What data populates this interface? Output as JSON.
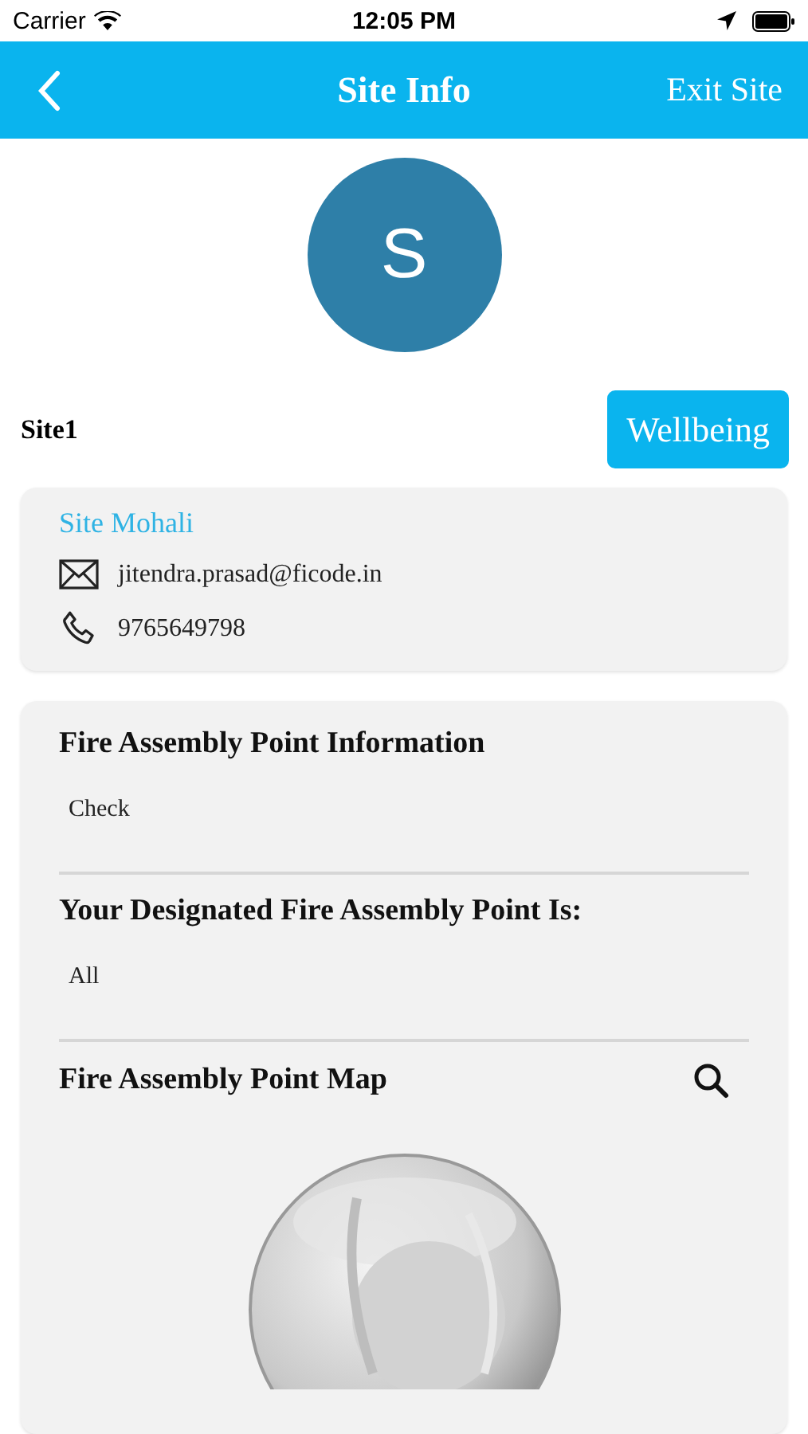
{
  "status_bar": {
    "carrier": "Carrier",
    "time": "12:05 PM"
  },
  "nav_bar": {
    "title": "Site Info",
    "action": "Exit Site"
  },
  "avatar": {
    "initial": "S"
  },
  "site": {
    "name": "Site1",
    "button": "Wellbeing"
  },
  "contact_card": {
    "title": "Site Mohali",
    "items": [
      {
        "kind": "email",
        "text": "jitendra.prasad@ficode.in"
      },
      {
        "kind": "phone",
        "text": "9765649798"
      }
    ]
  },
  "info_card": {
    "sections": [
      {
        "kind": "text",
        "heading": "Fire Assembly Point Information",
        "value": "Check"
      },
      {
        "kind": "text",
        "heading": "Your Designated Fire Assembly Point Is:",
        "value": "All"
      },
      {
        "kind": "map",
        "heading": "Fire Assembly Point Map"
      }
    ]
  }
}
